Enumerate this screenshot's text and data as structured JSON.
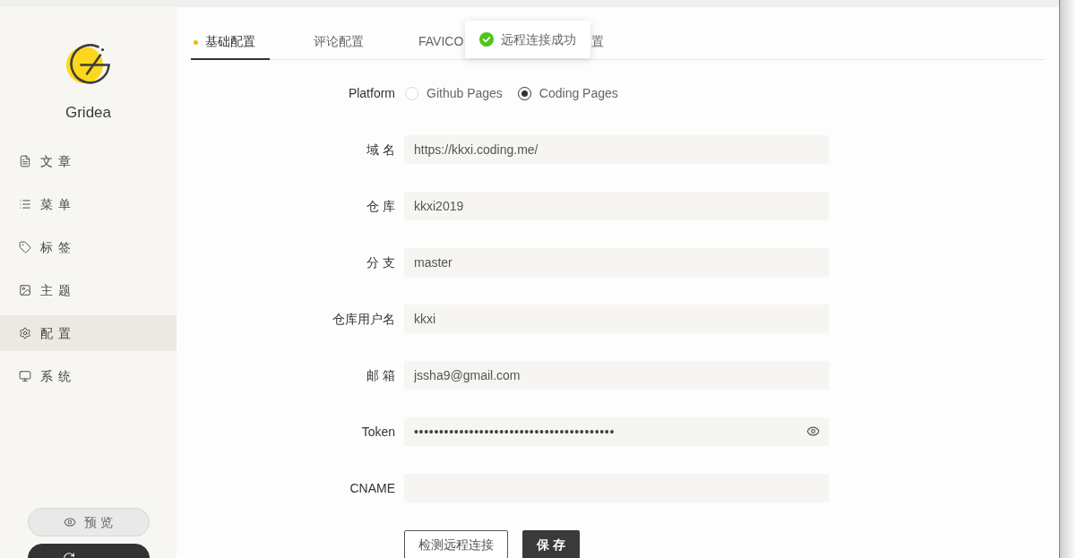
{
  "sidebar": {
    "app_name": "Gridea",
    "items": [
      {
        "label": "文 章",
        "selected": false
      },
      {
        "label": "菜 单",
        "selected": false
      },
      {
        "label": "标 签",
        "selected": false
      },
      {
        "label": "主 题",
        "selected": false
      },
      {
        "label": "配 置",
        "selected": true
      },
      {
        "label": "系 统",
        "selected": false
      }
    ],
    "buttons": [
      {
        "label": "预 览",
        "kind": "secondary"
      },
      {
        "kind": "primary"
      }
    ]
  },
  "tabs": [
    {
      "label": "基础配置",
      "selected": true
    },
    {
      "label": "评论配置",
      "selected": false
    },
    {
      "label": "FAVICO",
      "selected": false
    },
    {
      "label": "置",
      "selected": false
    }
  ],
  "toast": {
    "message": "远程连接成功"
  },
  "form": {
    "platform": {
      "label": "Platform",
      "options": [
        {
          "label": "Github Pages",
          "selected": false
        },
        {
          "label": "Coding Pages",
          "selected": true
        }
      ]
    },
    "fields": [
      {
        "label": "域 名",
        "kind": "text",
        "value": "https://kkxi.coding.me/"
      },
      {
        "label": "仓 库",
        "kind": "text",
        "value": "kkxi2019"
      },
      {
        "label": "分 支",
        "kind": "text",
        "value": "master"
      },
      {
        "label": "仓库用户名",
        "kind": "text",
        "value": "kkxi"
      },
      {
        "label": "邮 箱",
        "kind": "text",
        "value": "jssha9@gmail.com"
      },
      {
        "label": "Token",
        "kind": "password",
        "value": "••••••••••••••••••••••••••••••••••••••••"
      },
      {
        "label": "CNAME",
        "kind": "text"
      }
    ],
    "actions": [
      {
        "label": "检测远程连接",
        "kind": "outline"
      },
      {
        "label": "保 存",
        "kind": "primary"
      }
    ]
  }
}
